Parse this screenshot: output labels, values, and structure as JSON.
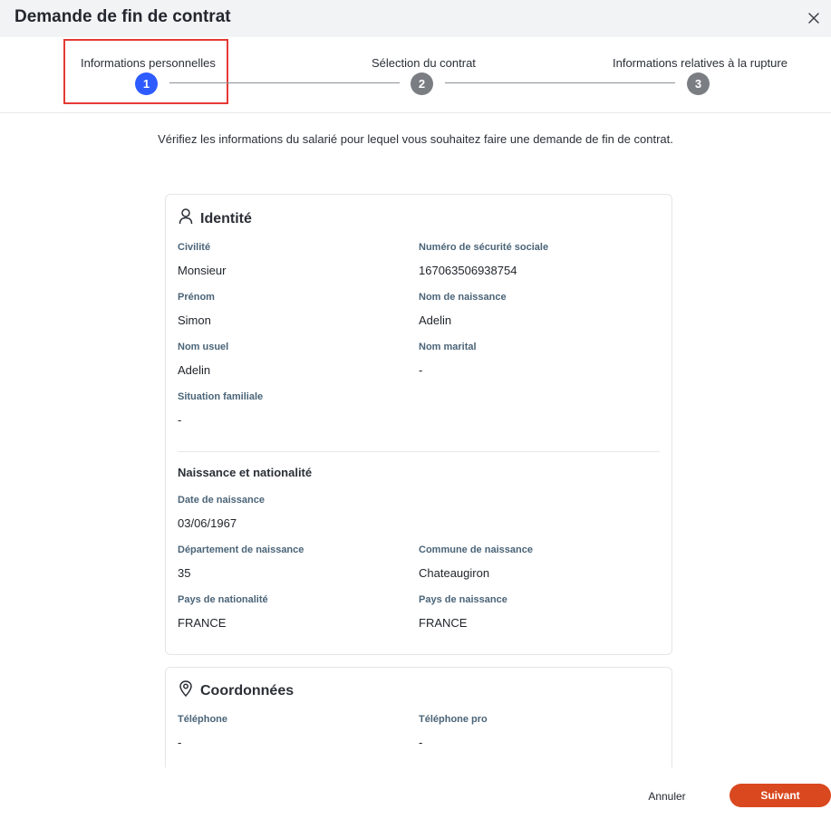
{
  "window": {
    "title": "Demande de fin de contrat"
  },
  "stepper": {
    "steps": [
      {
        "number": "1",
        "label": "Informations personnelles",
        "state": "active",
        "color": "#2d5bff"
      },
      {
        "number": "2",
        "label": "Sélection du contrat",
        "state": "inactive",
        "color": "#7a7d82"
      },
      {
        "number": "3",
        "label": "Informations relatives à la rupture",
        "state": "inactive",
        "color": "#7a7d82"
      }
    ]
  },
  "intro": "Vérifiez les informations du salarié pour lequel vous souhaitez faire une demande de fin de contrat.",
  "identite": {
    "title": "Identité",
    "icon": "person-icon",
    "fields": {
      "civilite": {
        "label": "Civilité",
        "value": "Monsieur"
      },
      "nss": {
        "label": "Numéro de sécurité sociale",
        "value": "167063506938754"
      },
      "prenom": {
        "label": "Prénom",
        "value": "Simon"
      },
      "nom_naissance": {
        "label": "Nom de naissance",
        "value": "Adelin"
      },
      "nom_usuel": {
        "label": "Nom usuel",
        "value": "Adelin"
      },
      "nom_marital": {
        "label": "Nom marital",
        "value": "-"
      },
      "situation": {
        "label": "Situation familiale",
        "value": "-"
      }
    },
    "naissance": {
      "title": "Naissance et nationalité",
      "fields": {
        "date": {
          "label": "Date de naissance",
          "value": "03/06/1967"
        },
        "departement": {
          "label": "Département de naissance",
          "value": "35"
        },
        "commune": {
          "label": "Commune de naissance",
          "value": "Chateaugiron"
        },
        "pays_nationalite": {
          "label": "Pays de nationalité",
          "value": "FRANCE"
        },
        "pays_naissance": {
          "label": "Pays de naissance",
          "value": "FRANCE"
        }
      }
    }
  },
  "coordonnees": {
    "title": "Coordonnées",
    "icon": "location-pin-icon",
    "fields": {
      "telephone": {
        "label": "Téléphone",
        "value": "-"
      },
      "telephone_pro": {
        "label": "Téléphone pro",
        "value": "-"
      }
    }
  },
  "footer": {
    "cancel_label": "Annuler",
    "next_label": "Suivant",
    "accent": "#d9481f"
  }
}
